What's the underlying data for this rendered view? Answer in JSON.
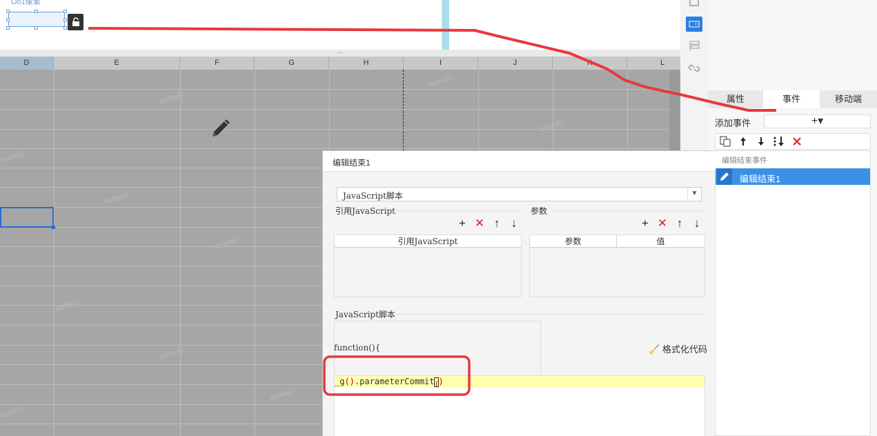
{
  "canvas": {
    "top_label": "Oo1像素",
    "lock_icon": "unlock-icon",
    "split_handle": "..."
  },
  "sheet": {
    "columns": [
      "D",
      "E",
      "F",
      "G",
      "H",
      "I",
      "J",
      "K",
      "L"
    ],
    "selected_column": "D",
    "watermark": "dodaqi()"
  },
  "right_panel": {
    "tabs": [
      {
        "label": "属性",
        "active": false
      },
      {
        "label": "事件",
        "active": true
      },
      {
        "label": "移动端",
        "active": false
      }
    ],
    "add_event_label": "添加事件",
    "add_event_button": "+▾",
    "group_label": "编辑结束事件",
    "event_item_label": "编辑结束1"
  },
  "dialog": {
    "title": "编辑结束1",
    "type_select": "JavaScript脚本",
    "ref_js_label": "引用JavaScript",
    "ref_js_col": "引用JavaScript",
    "params_label": "参数",
    "params_col1": "参数",
    "params_col2": "值",
    "script_label": "JavaScript脚本",
    "fn_line": "function(){",
    "format_button": "格式化代码",
    "code": {
      "prefix": "_g",
      "paren1": "()",
      "middle": ".parameterCommit",
      "open": "(",
      "close": ")"
    }
  },
  "colors": {
    "accent": "#2c7fe2",
    "annotation": "#e8383d",
    "code_highlight": "#ffffb0"
  }
}
